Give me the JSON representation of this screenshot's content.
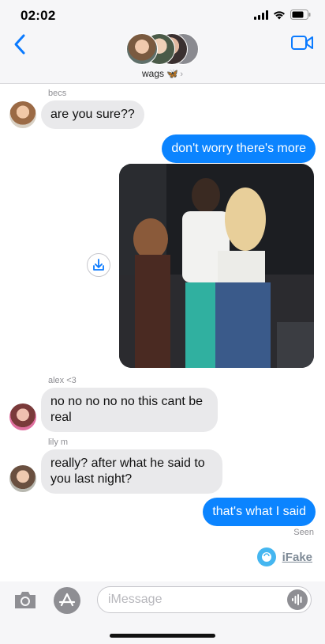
{
  "status_bar": {
    "time": "02:02"
  },
  "header": {
    "group_name": "wags 🦋",
    "chevron": "›"
  },
  "messages": [
    {
      "sender": "becs",
      "text": "are you sure??",
      "direction": "in"
    },
    {
      "text": "don't worry there's more",
      "direction": "out"
    },
    {
      "type": "image",
      "direction": "out"
    },
    {
      "sender": "alex <3",
      "text": "no no no no no this cant be real",
      "direction": "in"
    },
    {
      "sender": "lily m",
      "text": "really? after what he said to you last night?",
      "direction": "in"
    },
    {
      "text": "that's what I said",
      "direction": "out"
    }
  ],
  "seen_label": "Seen",
  "watermark": {
    "label": "iFake"
  },
  "compose": {
    "placeholder": "iMessage"
  },
  "colors": {
    "outgoing": "#0b84ff",
    "incoming": "#e9e9eb",
    "link": "#0a7aff"
  },
  "icons": [
    "back-chevron-icon",
    "video-call-icon",
    "camera-icon",
    "app-store-icon",
    "audio-waveform-icon",
    "download-icon",
    "battery-icon",
    "wifi-icon",
    "signal-icon"
  ]
}
